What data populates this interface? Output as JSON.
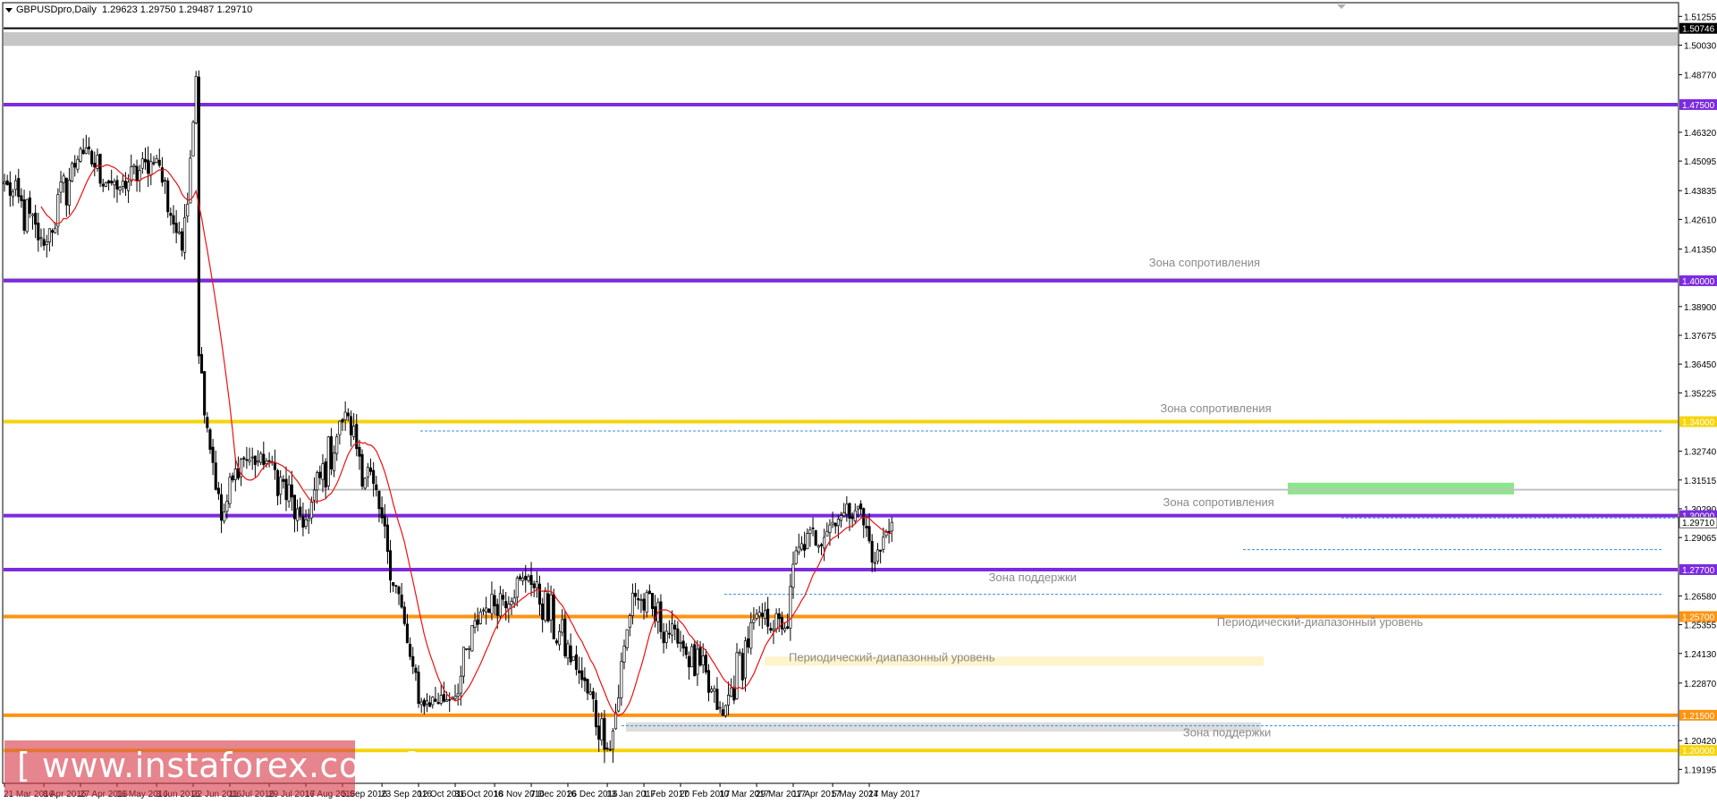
{
  "title_bar": {
    "symbol_timeframe": "GBPUSDpro,Daily",
    "ohlc": "1.29623 1.29750 1.29487 1.29710"
  },
  "watermark": {
    "text": "[ www.instaforex.com ]"
  },
  "colors": {
    "candle": "#000000",
    "ma": "#ee1111",
    "purple_level": "#7b2be0",
    "yellow_level": "#f7d40a",
    "orange_level": "#ff9410",
    "gray_level": "#c0c0c0",
    "green_zone": "#66dd66",
    "dotted_level": "#3b8fd9",
    "watermark_bg": "#d63a48"
  },
  "chart_data": {
    "type": "candlestick",
    "instrument": "GBPUSD",
    "timeframe": "Daily",
    "ylim": [
      1.186,
      1.518
    ],
    "y_ticks": [
      "1.51255",
      "1.50030",
      "1.48770",
      "1.46320",
      "1.45095",
      "1.43835",
      "1.42610",
      "1.41350",
      "1.38900",
      "1.37675",
      "1.36450",
      "1.35225",
      "1.32740",
      "1.31515",
      "1.30290",
      "1.29065",
      "1.26580",
      "1.25355",
      "1.24130",
      "1.22870",
      "1.20420",
      "1.19195"
    ],
    "x_ticks": [
      "21 Mar 2016",
      "8 Apr 2016",
      "27 Apr 2016",
      "16 May 2016",
      "3 Jun 2016",
      "22 Jun 2016",
      "11 Jul 2016",
      "29 Jul 2016",
      "17 Aug 2016",
      "5 Sep 2016",
      "23 Sep 2016",
      "12 Oct 2016",
      "31 Oct 2016",
      "18 Nov 2016",
      "7 Dec 2016",
      "26 Dec 2016",
      "13 Jan 2017",
      "1 Feb 2017",
      "20 Feb 2017",
      "10 Mar 2017",
      "29 Mar 2017",
      "17 Apr 2017",
      "5 May 2017",
      "24 May 2017"
    ],
    "current_price": 1.2971,
    "horizontal_levels": [
      {
        "price": 1.50746,
        "style": "solid",
        "color": "#000000",
        "label": "1.50746"
      },
      {
        "price": 1.503,
        "style": "band",
        "color": "#c0c0c0",
        "label": ""
      },
      {
        "price": 1.475,
        "style": "solid",
        "color": "#7b2be0",
        "label": "1.47500"
      },
      {
        "price": 1.4,
        "style": "solid",
        "color": "#7b2be0",
        "label": "1.40000"
      },
      {
        "price": 1.34,
        "style": "solid",
        "color": "#f7d40a",
        "label": "1.34000"
      },
      {
        "price": 1.3,
        "style": "solid",
        "color": "#7b2be0",
        "label": "1.30000"
      },
      {
        "price": 1.277,
        "style": "solid",
        "color": "#7b2be0",
        "label": "1.27700"
      },
      {
        "price": 1.257,
        "style": "solid",
        "color": "#ff9410",
        "label": "1.25700"
      },
      {
        "price": 1.215,
        "style": "solid",
        "color": "#ff9410",
        "label": "1.21500"
      },
      {
        "price": 1.2,
        "style": "solid",
        "color": "#f7d40a",
        "label": "1.20000"
      }
    ],
    "annotations": [
      {
        "text": "Зона сопротивления",
        "price": 1.406,
        "date_index": 426
      },
      {
        "text": "Зона сопротивления",
        "price": 1.344,
        "date_index": 430
      },
      {
        "text": "Зона сопротивления",
        "price": 1.304,
        "date_index": 431
      },
      {
        "text": "Зона поддержки",
        "price": 1.272,
        "date_index": 365
      },
      {
        "text": "Периодический-диапазонный уровень",
        "price": 1.253,
        "date_index": 467
      },
      {
        "text": "Периодический-диапазонный уровень",
        "price": 1.238,
        "date_index": 315
      },
      {
        "text": "Зона поддержки",
        "price": 1.206,
        "date_index": 434
      }
    ],
    "price_series": [
      {
        "date": "2016-03-21",
        "close": 1.442
      },
      {
        "date": "2016-04-08",
        "close": 1.415
      },
      {
        "date": "2016-04-27",
        "close": 1.456
      },
      {
        "date": "2016-05-16",
        "close": 1.439
      },
      {
        "date": "2016-06-03",
        "close": 1.452
      },
      {
        "date": "2016-06-16",
        "close": 1.413
      },
      {
        "date": "2016-06-23",
        "close": 1.487
      },
      {
        "date": "2016-06-24",
        "close": 1.368
      },
      {
        "date": "2016-07-06",
        "close": 1.298
      },
      {
        "date": "2016-07-15",
        "close": 1.324
      },
      {
        "date": "2016-07-29",
        "close": 1.323
      },
      {
        "date": "2016-08-16",
        "close": 1.295
      },
      {
        "date": "2016-09-06",
        "close": 1.344
      },
      {
        "date": "2016-09-23",
        "close": 1.299
      },
      {
        "date": "2016-10-07",
        "close": 1.24
      },
      {
        "date": "2016-10-12",
        "close": 1.22
      },
      {
        "date": "2016-10-31",
        "close": 1.223
      },
      {
        "date": "2016-11-11",
        "close": 1.259
      },
      {
        "date": "2016-12-06",
        "close": 1.274
      },
      {
        "date": "2016-12-30",
        "close": 1.233
      },
      {
        "date": "2017-01-16",
        "close": 1.2
      },
      {
        "date": "2017-01-26",
        "close": 1.267
      },
      {
        "date": "2017-02-20",
        "close": 1.246
      },
      {
        "date": "2017-03-13",
        "close": 1.215
      },
      {
        "date": "2017-03-29",
        "close": 1.258
      },
      {
        "date": "2017-04-13",
        "close": 1.252
      },
      {
        "date": "2017-04-18",
        "close": 1.285
      },
      {
        "date": "2017-05-10",
        "close": 1.3
      },
      {
        "date": "2017-05-18",
        "close": 1.304
      },
      {
        "date": "2017-05-26",
        "close": 1.28
      },
      {
        "date": "2017-06-05",
        "close": 1.2971
      }
    ]
  }
}
